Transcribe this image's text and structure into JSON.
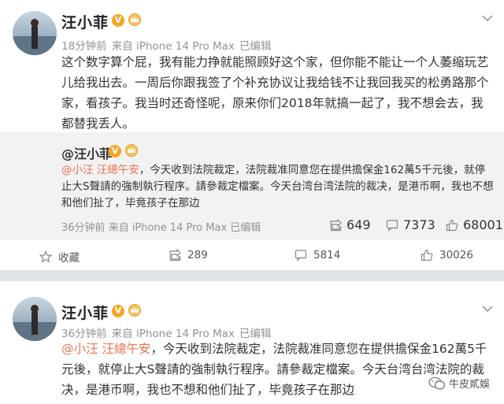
{
  "post1": {
    "author": "汪小菲",
    "verified_badge": "V",
    "time": "18分钟前",
    "source": "来自 iPhone 14 Pro Max",
    "edited": "已编辑",
    "text": "这个数字算个屁，我有能力挣就能照顾好这个家，但你能不能让一个人萎缩玩艺儿给我出去。一周后你跟我签了个补充协议让我给钱不让我回我买的松勇路那个家，看孩子。我当时还奇怪呢，原来你们2018年就搞一起了，我不想会去，我都替我丢人。",
    "repost": {
      "author": "@汪小菲",
      "mention": "@小汪 汪總午安",
      "text_rest": "，今天收到法院裁定，法院裁准同意您在提供擔保金162萬5千元後，就停止大S聲請的強制執行程序。請參裁定檔案。今天台湾台湾法院的裁决，是港币啊，我也不想和他们扯了，毕竟孩子在那边",
      "time": "36分钟前",
      "source": "来自 iPhone 14 Pro Max",
      "edited": "已编辑",
      "reposts": "649",
      "comments": "7373",
      "likes": "68001"
    },
    "actions": {
      "favorite": "收藏",
      "repost": "289",
      "comment": "5814",
      "like": "30026"
    }
  },
  "post2": {
    "author": "汪小菲",
    "verified_badge": "V",
    "time": "36分钟前",
    "source": "来自 iPhone 14 Pro Max",
    "edited": "已编辑",
    "mention": "@小汪 汪總午安",
    "text_rest": "，今天收到法院裁定，法院裁准同意您在提供擔保金162萬5千元後，就停止大S聲請的強制執行程序。請參裁定檔案。今天台湾台湾法院的裁决，是港币啊，我也不想和他们扯了，毕竟孩子在那边"
  },
  "watermark": "牛皮貳娛",
  "colors": {
    "mention": "#eb7350",
    "badge": "#f5a623",
    "divider": "#dfe4e6",
    "repost_bg": "#f2f2f2"
  }
}
